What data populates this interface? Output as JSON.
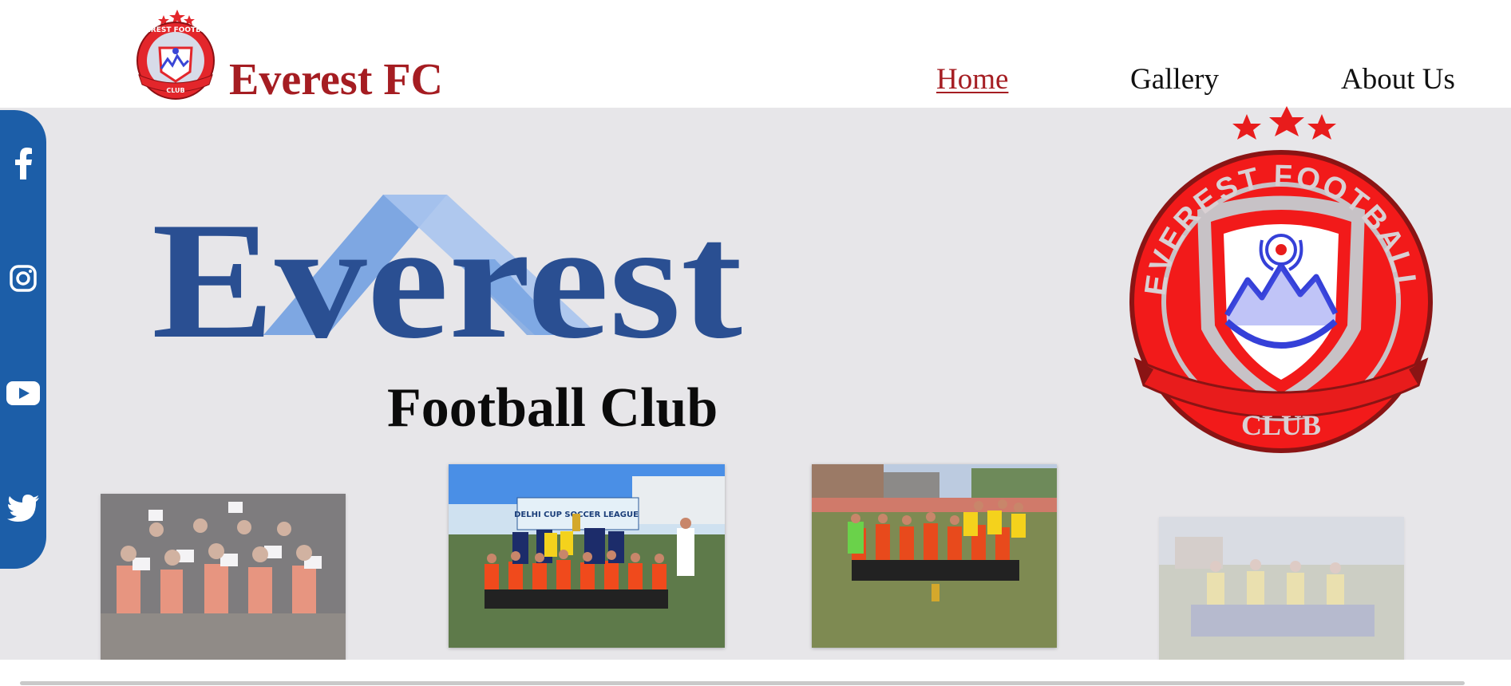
{
  "header": {
    "brand_name": "Everest FC",
    "logo_icon": "everest-fc-crest",
    "nav": [
      {
        "label": "Home",
        "active": true
      },
      {
        "label": "Gallery",
        "active": false
      },
      {
        "label": "About Us",
        "active": false
      }
    ]
  },
  "hero": {
    "wordmark": "Everest",
    "subtitle": "Football Club",
    "crest": {
      "top_text": "EVEREST FOOTBALL",
      "bottom_text": "CLUB"
    }
  },
  "social_links": [
    {
      "icon": "facebook-icon"
    },
    {
      "icon": "instagram-icon"
    },
    {
      "icon": "youtube-icon"
    },
    {
      "icon": "twitter-icon"
    }
  ],
  "photos": [
    {
      "name": "team-photo-1",
      "description_icon": "photo"
    },
    {
      "name": "team-photo-2",
      "banner_text": "DELHI CUP SOCCER LEAGUE"
    },
    {
      "name": "team-photo-3"
    },
    {
      "name": "team-photo-4"
    }
  ],
  "colors": {
    "brand_red": "#a51d22",
    "social_blue": "#1c5ea8",
    "hero_bg": "#e7e6e9",
    "wordmark_dark": "#2a4f92",
    "wordmark_light": "#6b9be0"
  }
}
